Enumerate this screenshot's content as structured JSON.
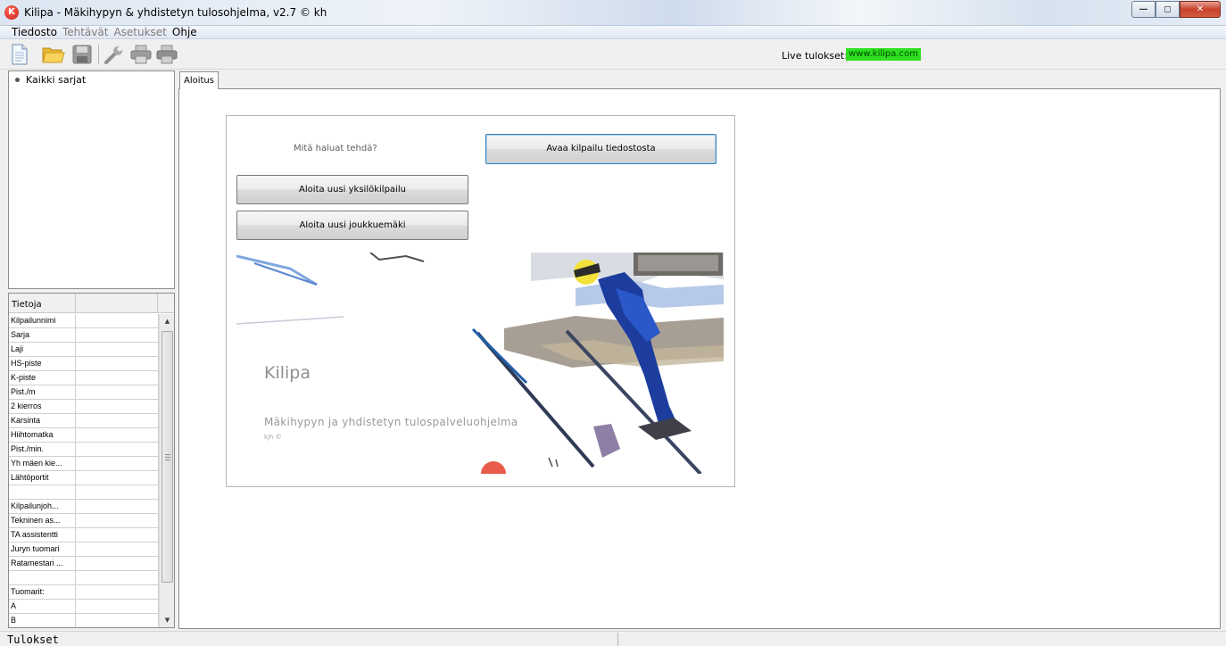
{
  "window": {
    "title": "Kilipa - Mäkihypyn & yhdistetyn tulosohjelma, v2.7 © kh",
    "icon_letter": "K",
    "minimize_glyph": "—",
    "maximize_glyph": "◻",
    "close_glyph": "✕"
  },
  "menu": {
    "items": [
      {
        "label": "Tiedosto",
        "enabled": true
      },
      {
        "label": "Tehtävät",
        "enabled": false
      },
      {
        "label": "Asetukset",
        "enabled": false
      },
      {
        "label": "Ohje",
        "enabled": true
      }
    ]
  },
  "toolbar": {
    "icons": [
      "new-document-icon",
      "open-folder-icon",
      "save-icon",
      "settings-wrench-icon",
      "print-icon",
      "print-preview-icon"
    ],
    "live_label": "Live tulokset:",
    "live_link": "www.kilipa.com",
    "live_color": "#2fe021"
  },
  "tree": {
    "items": [
      {
        "label": "Kaikki sarjat"
      }
    ]
  },
  "info_grid": {
    "header": "Tietoja",
    "rows": [
      "Kilpailunnimi",
      "Sarja",
      "Laji",
      "HS-piste",
      "K-piste",
      "Pist./m",
      "2 kierros",
      "Karsinta",
      "Hiihtomatka",
      "Pist./min.",
      "Yh mäen kie...",
      "Lähtöportit",
      "",
      "Kilpailunjoh...",
      "Tekninen as...",
      "TA assistentti",
      "Juryn tuomari",
      "Ratamestari ...",
      "",
      "Tuomarit:",
      "A",
      "B"
    ]
  },
  "tabs": [
    {
      "label": "Aloitus",
      "active": true
    }
  ],
  "start": {
    "question": "Mitä haluat tehdä?",
    "open_button": "Avaa kilpailu tiedostosta",
    "single_button": "Aloita uusi yksilökilpailu",
    "team_button": "Aloita uusi joukkuemäki",
    "hero_title": "Kilipa",
    "hero_subtitle": "Mäkihypyn ja yhdistetyn tulospalveluohjelma",
    "hero_small": "kjh ©"
  },
  "status": {
    "left": "Tulokset",
    "right": ""
  }
}
